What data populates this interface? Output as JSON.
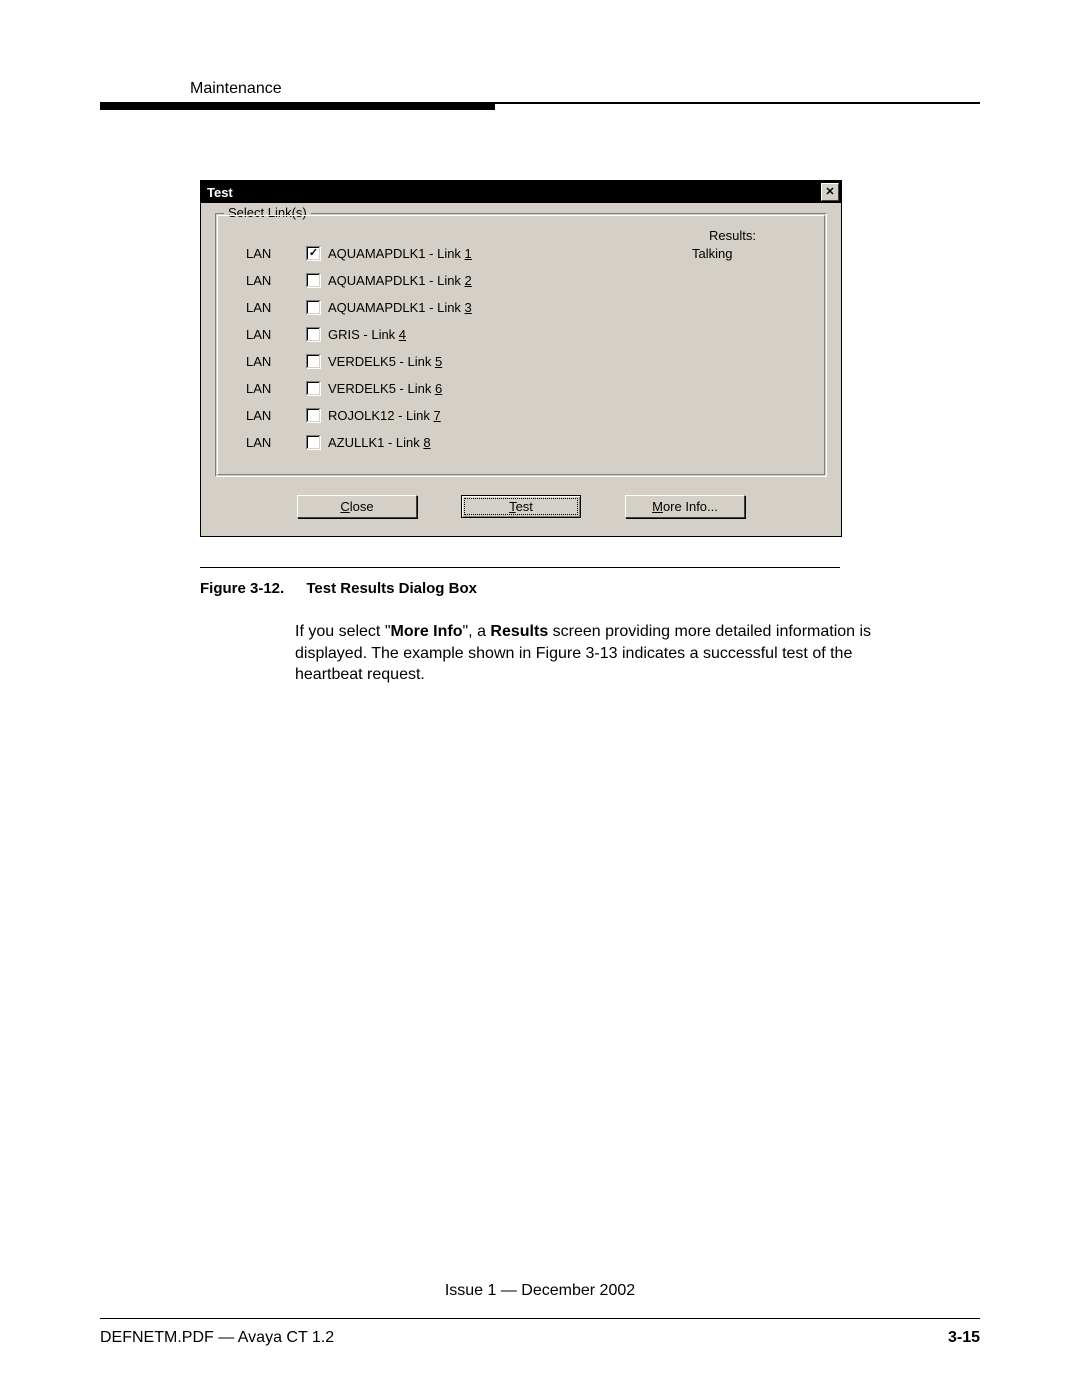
{
  "header": {
    "section": "Maintenance"
  },
  "dialog": {
    "title": "Test",
    "close_glyph": "✕",
    "group_legend": "Select Link(s)",
    "results_header": "Results:",
    "links": [
      {
        "type": "LAN",
        "checked": true,
        "name": "AQUAMAPDLK1 - Link ",
        "accel": "1",
        "result": "Talking"
      },
      {
        "type": "LAN",
        "checked": false,
        "name": "AQUAMAPDLK1 - Link ",
        "accel": "2",
        "result": ""
      },
      {
        "type": "LAN",
        "checked": false,
        "name": "AQUAMAPDLK1 - Link ",
        "accel": "3",
        "result": ""
      },
      {
        "type": "LAN",
        "checked": false,
        "name": "GRIS - Link ",
        "accel": "4",
        "result": ""
      },
      {
        "type": "LAN",
        "checked": false,
        "name": "VERDELK5 - Link ",
        "accel": "5",
        "result": ""
      },
      {
        "type": "LAN",
        "checked": false,
        "name": "VERDELK5 - Link ",
        "accel": "6",
        "result": ""
      },
      {
        "type": "LAN",
        "checked": false,
        "name": "ROJOLK12 - Link ",
        "accel": "7",
        "result": ""
      },
      {
        "type": "LAN",
        "checked": false,
        "name": "AZULLK1 - Link ",
        "accel": "8",
        "result": ""
      }
    ],
    "buttons": {
      "close_pre": "",
      "close_accel": "C",
      "close_post": "lose",
      "test_pre": "",
      "test_accel": "T",
      "test_post": "est",
      "more_pre": "",
      "more_accel": "M",
      "more_post": "ore Info..."
    }
  },
  "figure": {
    "num": "Figure 3-12.",
    "title": "Test Results Dialog Box"
  },
  "paragraph": {
    "p1a": "If you select \"",
    "p1b": "More Info",
    "p1c": "\", a ",
    "p1d": "Results",
    "p1e": " screen providing more detailed information is displayed. The example shown in Figure 3-13 indicates a successful test of the heartbeat request."
  },
  "footer": {
    "issue": "Issue 1 — December 2002",
    "doc": "DEFNETM.PDF — Avaya CT 1.2",
    "page": "3-15"
  }
}
